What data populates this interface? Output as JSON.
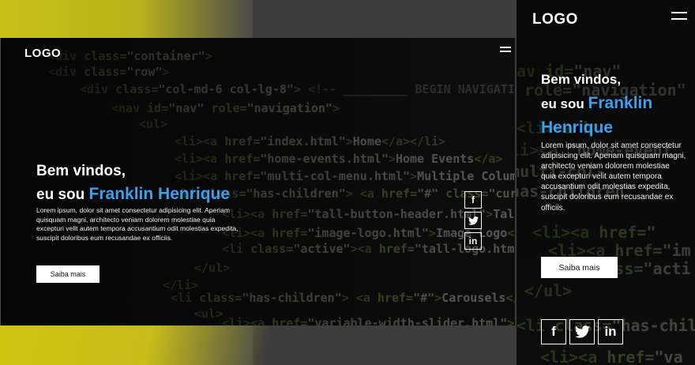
{
  "desktop": {
    "logo": "LOGO",
    "greeting_line1": "Bem vindos,",
    "greeting_prefix": "eu sou ",
    "name": "Franklin Henrique",
    "paragraph": "Lorem ipsum, dolor sit amet consectetur adipisicing elit. Aperiam quisquam magni, architecto veniam dolorem molestiae quia excepturi velit autem tempora accusantium odit molestias expedita, suscipit doloribus eum recusandae ex officiis.",
    "button_label": "Saiba mais"
  },
  "mobile": {
    "logo": "LOGO",
    "greeting_line1": "Bem vindos,",
    "greeting_prefix": "eu sou ",
    "name": "Franklin Henrique",
    "paragraph": "Lorem ipsum, dolor sit amet consectetur adipisicing elit. Aperiam quisquam magni, architecto veniam dolorem molestiae quia excepturi velit autem tempora accusantium odit molestias expedita, suscipit doloribus eum recusandae ex officiis.",
    "button_label": "Saiba mais"
  },
  "social": {
    "facebook": "f",
    "twitter": "🐦",
    "linkedin": "in"
  },
  "icons": [
    "hamburger-menu-icon",
    "facebook-icon",
    "twitter-icon",
    "linkedin-icon"
  ],
  "colors": {
    "accent": "#3aa0f0",
    "backdrop_yellow": "#c9c016",
    "button_bg": "#ffffff"
  }
}
